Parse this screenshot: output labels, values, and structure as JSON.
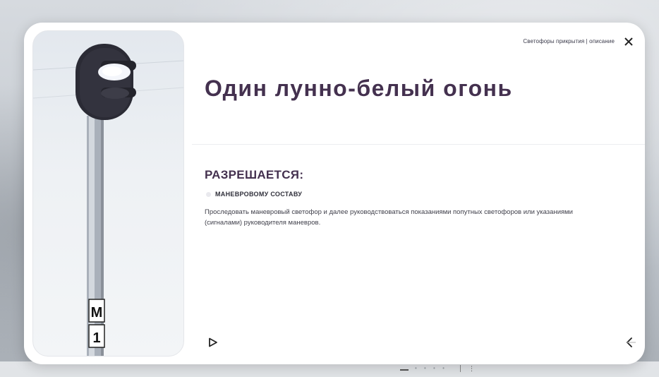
{
  "modal": {
    "breadcrumb": "Светофоры прикрытия  |  описание",
    "title": "Один лунно-белый огонь",
    "section_heading": "РАЗРЕШАЕТСЯ:",
    "recipient": "МАНЕВРОВОМУ СОСТАВУ",
    "description": "Проследовать маневровый светофор и далее руководствоваться показаниями попутных светофоров или указаниями (сигналами) руководителя маневров.",
    "signal_plates": [
      "М",
      "1"
    ]
  },
  "icons": {
    "close": "close-icon",
    "play": "play-icon",
    "back": "back-arrow-icon",
    "light": "lunar-white-light"
  },
  "colors": {
    "title": "#44314f",
    "signal_head": "#2b2b35",
    "lunar_white": "#f4f6fb"
  }
}
